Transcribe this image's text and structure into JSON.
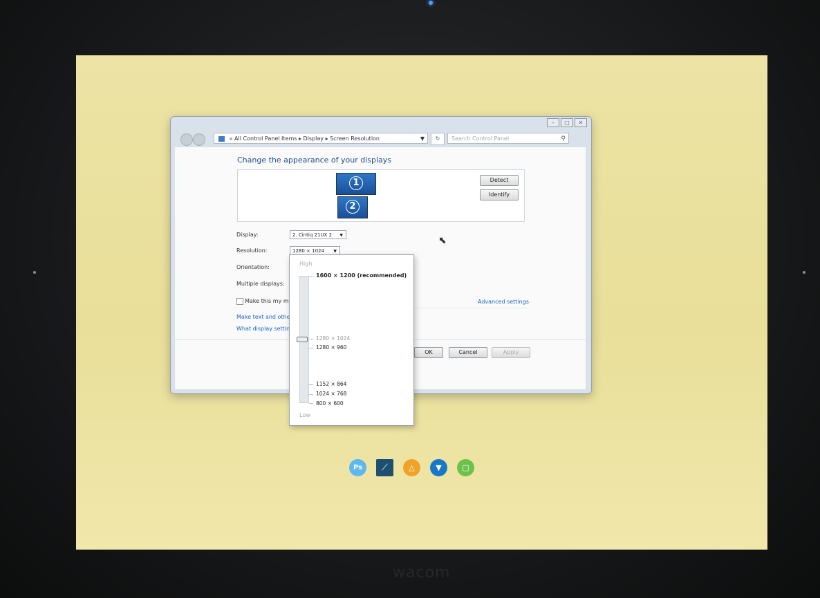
{
  "device": {
    "brand": "wacom"
  },
  "window": {
    "controls": [
      "–",
      "□",
      "✕"
    ],
    "breadcrumb": {
      "prefix": "«",
      "items": [
        "All Control Panel Items",
        "Display",
        "Screen Resolution"
      ]
    },
    "search_placeholder": "Search Control Panel",
    "heading": "Change the appearance of your displays",
    "monitors": [
      "1",
      "2"
    ],
    "detect_label": "Detect",
    "identify_label": "Identify",
    "display_label": "Display:",
    "display_value": "2. Cintiq 21UX 2",
    "resolution_label": "Resolution:",
    "resolution_value": "1280 × 1024",
    "orientation_label": "Orientation:",
    "multiple_displays_label": "Multiple displays:",
    "make_main_label": "Make this my m",
    "advanced_settings": "Advanced settings",
    "link_text_size": "Make text and othe",
    "link_what_settings": "What display setting",
    "ok_label": "OK",
    "cancel_label": "Cancel",
    "apply_label": "Apply"
  },
  "resolution_popup": {
    "high_label": "High",
    "low_label": "Low",
    "recommended": "1600 × 1200 (recommended)",
    "current": "1280 × 1024",
    "options": [
      "1280 × 960",
      "1152 × 864",
      "1024 × 768",
      "800 × 600"
    ],
    "slider_level_percent": 50
  },
  "dock": {
    "items": [
      {
        "name": "photoshop-icon",
        "label": "Ps",
        "color": "#5eb8f0"
      },
      {
        "name": "sketchbook-icon",
        "label": "",
        "color": "#1f4e6e"
      },
      {
        "name": "orange-app-icon",
        "label": "",
        "color": "#f0a32a"
      },
      {
        "name": "blue-pen-app-icon",
        "label": "",
        "color": "#1877c9"
      },
      {
        "name": "green-app-icon",
        "label": "",
        "color": "#6cc24a"
      }
    ]
  }
}
